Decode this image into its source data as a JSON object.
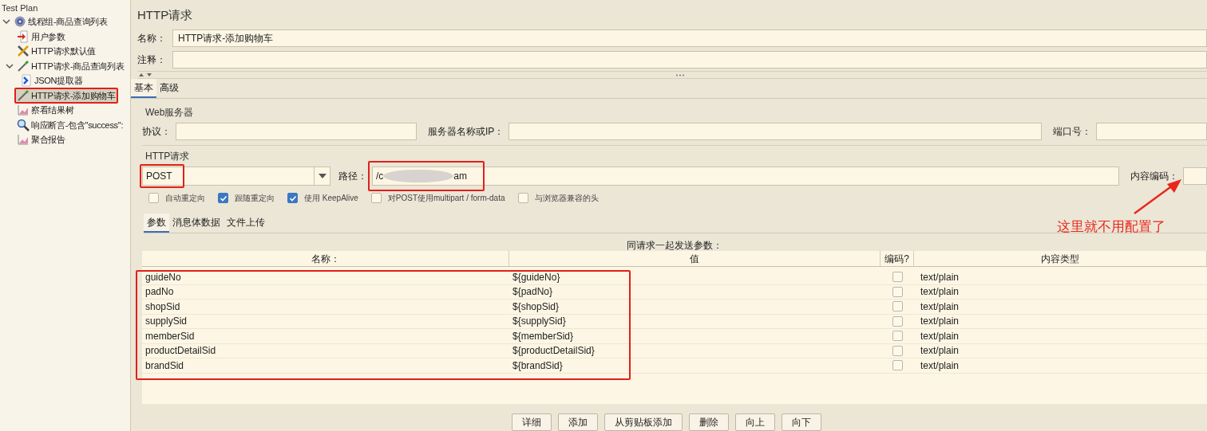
{
  "tree": {
    "root": "Test Plan",
    "items": [
      {
        "label": "线程组-商品查询列表",
        "kind": "thread-group",
        "selected": false,
        "highlighted": false,
        "expanded": true,
        "children": [
          {
            "label": "用户参数",
            "kind": "user-params",
            "selected": false,
            "highlighted": false
          },
          {
            "label": "HTTP请求默认值",
            "kind": "defaults",
            "selected": false,
            "highlighted": false
          },
          {
            "label": "HTTP请求-商品查询列表",
            "kind": "sampler",
            "selected": false,
            "highlighted": false,
            "expanded": true,
            "children": [
              {
                "label": "JSON提取器",
                "kind": "extractor",
                "selected": false,
                "highlighted": false
              }
            ]
          },
          {
            "label": "HTTP请求-添加购物车",
            "kind": "sampler",
            "selected": true,
            "highlighted": true
          },
          {
            "label": "察看结果树",
            "kind": "listener",
            "selected": false,
            "highlighted": false
          },
          {
            "label": "响应断言-包含\"success\":",
            "kind": "assertion",
            "selected": false,
            "highlighted": false
          },
          {
            "label": "聚合报告",
            "kind": "listener",
            "selected": false,
            "highlighted": false
          }
        ]
      }
    ]
  },
  "panel": {
    "title": "HTTP请求",
    "name_label": "名称：",
    "name_value": "HTTP请求-添加购物车",
    "comment_label": "注释：",
    "tabs": [
      {
        "label": "基本",
        "selected": true
      },
      {
        "label": "高级",
        "selected": false
      }
    ],
    "web_server": {
      "legend": "Web服务器",
      "protocol_label": "协议：",
      "server_label": "服务器名称或IP：",
      "port_label": "端口号："
    },
    "http_request": {
      "legend": "HTTP请求",
      "method": "POST",
      "method_highlighted": true,
      "path_label": "路径：",
      "path_start": "/c",
      "path_end": "am",
      "path_highlighted": true,
      "encoding_label": "内容编码："
    },
    "options": [
      {
        "label": "自动重定向",
        "checked": false
      },
      {
        "label": "跟随重定向",
        "checked": true
      },
      {
        "label": "使用 KeepAlive",
        "checked": true
      },
      {
        "label": "对POST使用multipart / form-data",
        "checked": false
      },
      {
        "label": "与浏览器兼容的头",
        "checked": false
      }
    ],
    "sub_tabs": [
      {
        "label": "参数",
        "selected": true
      },
      {
        "label": "消息体数据",
        "selected": false
      },
      {
        "label": "文件上传",
        "selected": false
      }
    ],
    "params_caption": "同请求一起发送参数：",
    "table": {
      "columns": [
        "名称：",
        "值",
        "编码?",
        "内容类型"
      ],
      "rows_highlighted": true,
      "rows": [
        {
          "name": "guideNo",
          "value": "${guideNo}",
          "encode": false,
          "content_type": "text/plain"
        },
        {
          "name": "padNo",
          "value": "${padNo}",
          "encode": false,
          "content_type": "text/plain"
        },
        {
          "name": "shopSid",
          "value": "${shopSid}",
          "encode": false,
          "content_type": "text/plain"
        },
        {
          "name": "supplySid",
          "value": "${supplySid}",
          "encode": false,
          "content_type": "text/plain"
        },
        {
          "name": "memberSid",
          "value": "${memberSid}",
          "encode": false,
          "content_type": "text/plain"
        },
        {
          "name": "productDetailSid",
          "value": "${productDetailSid}",
          "encode": false,
          "content_type": "text/plain"
        },
        {
          "name": "brandSid",
          "value": "${brandSid}",
          "encode": false,
          "content_type": "text/plain"
        }
      ]
    },
    "buttons": [
      "详细",
      "添加",
      "从剪贴板添加",
      "删除",
      "向上",
      "向下"
    ]
  },
  "annotation": {
    "note": "这里就不用配置了"
  }
}
